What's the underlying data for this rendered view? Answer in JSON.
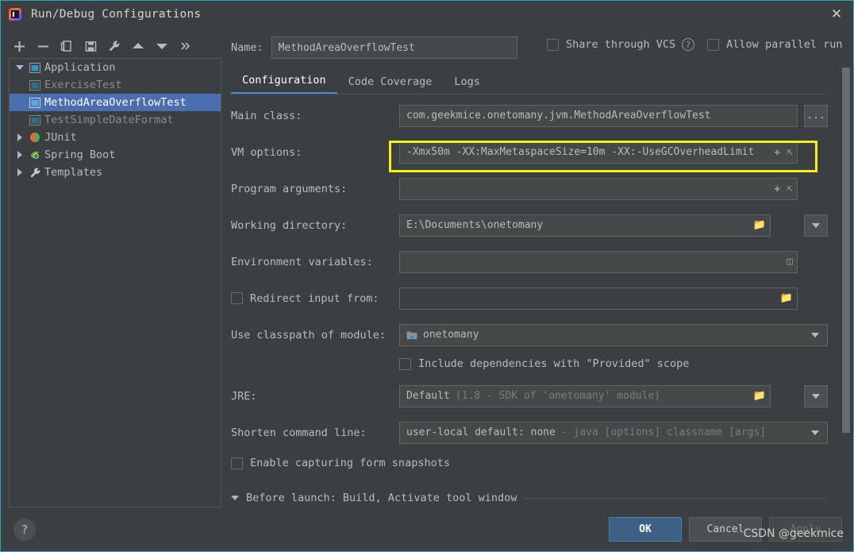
{
  "window": {
    "title": "Run/Debug Configurations",
    "app_icon": "intellij-idea-icon",
    "close_label": "✕"
  },
  "toolbar": {
    "buttons": [
      {
        "name": "add-configuration-button",
        "icon": "plus-icon",
        "label": "+"
      },
      {
        "name": "remove-configuration-button",
        "icon": "minus-icon",
        "label": "−"
      },
      {
        "name": "copy-configuration-button",
        "icon": "copy-icon",
        "label": "copy"
      },
      {
        "name": "save-configuration-button",
        "icon": "save-icon",
        "label": "save"
      },
      {
        "name": "edit-templates-button",
        "icon": "wrench-icon",
        "label": "wrench"
      },
      {
        "name": "move-up-button",
        "icon": "arrow-up-icon",
        "label": "up"
      },
      {
        "name": "move-down-button",
        "icon": "arrow-down-icon",
        "label": "down"
      },
      {
        "name": "more-options-button",
        "icon": "chevron-double-right-icon",
        "label": "»"
      }
    ]
  },
  "tree": {
    "nodes": [
      {
        "label": "Application",
        "icon": "application-icon",
        "expanded": true,
        "level": 0,
        "selected": false,
        "dim": false
      },
      {
        "label": "ExerciseTest",
        "icon": "run-config-icon",
        "level": 1,
        "selected": false,
        "dim": true
      },
      {
        "label": "MethodAreaOverflowTest",
        "icon": "run-config-icon",
        "level": 1,
        "selected": true,
        "dim": false
      },
      {
        "label": "TestSimpleDateFormat",
        "icon": "run-config-icon",
        "level": 1,
        "selected": false,
        "dim": true
      },
      {
        "label": "JUnit",
        "icon": "junit-icon",
        "expanded": false,
        "level": 0,
        "selected": false,
        "dim": false
      },
      {
        "label": "Spring Boot",
        "icon": "spring-boot-icon",
        "expanded": false,
        "level": 0,
        "selected": false,
        "dim": false
      },
      {
        "label": "Templates",
        "icon": "templates-wrench-icon",
        "expanded": false,
        "level": 0,
        "selected": false,
        "dim": false
      }
    ]
  },
  "header": {
    "name_label": "Name:",
    "name_value": "MethodAreaOverflowTest",
    "share_vcs_label": "Share through VCS",
    "share_vcs_checked": false,
    "help_icon": "question-circle-icon",
    "allow_parallel_label": "Allow parallel run",
    "allow_parallel_checked": false
  },
  "tabs": [
    {
      "label": "Configuration",
      "active": true
    },
    {
      "label": "Code Coverage",
      "active": false
    },
    {
      "label": "Logs",
      "active": false
    }
  ],
  "form": {
    "main_class": {
      "label": "Main class:",
      "value": "com.geekmice.onetomany.jvm.MethodAreaOverflowTest",
      "browse_label": "..."
    },
    "vm_options": {
      "label": "VM options:",
      "value": "-Xmx50m -XX:MaxMetaspaceSize=10m -XX:-UseGCOverheadLimit",
      "highlight_color": "#f7f114"
    },
    "program_arguments": {
      "label": "Program arguments:",
      "value": ""
    },
    "working_directory": {
      "label": "Working directory:",
      "value": "E:\\Documents\\onetomany"
    },
    "environment_variables": {
      "label": "Environment variables:",
      "value": ""
    },
    "redirect_input": {
      "label": "Redirect input from:",
      "checked": false,
      "value": ""
    },
    "use_classpath": {
      "label": "Use classpath of module:",
      "value": "onetomany"
    },
    "include_provided": {
      "label": "Include dependencies with \"Provided\" scope",
      "checked": false
    },
    "jre": {
      "label": "JRE:",
      "value": "Default",
      "hint": "(1.8 - SDK of 'onetomany' module)"
    },
    "shorten_command_line": {
      "label": "Shorten command line:",
      "value": "user-local default: none",
      "hint": "- java [options] classname [args]"
    },
    "form_snapshots": {
      "label": "Enable capturing form snapshots",
      "checked": false
    }
  },
  "before_launch": {
    "label": "Before launch: Build, Activate tool window",
    "expanded": true
  },
  "footer": {
    "help_label": "?",
    "ok_label": "OK",
    "cancel_label": "Cancel",
    "apply_label": "Apply",
    "apply_disabled": true
  },
  "watermark": "CSDN @geekmice",
  "colors": {
    "background": "#3c3f41",
    "field_background": "#45494a",
    "selection": "#4b6eaf",
    "accent": "#4a88c7",
    "primary_button": "#3d6185",
    "highlight": "#f7f114"
  }
}
